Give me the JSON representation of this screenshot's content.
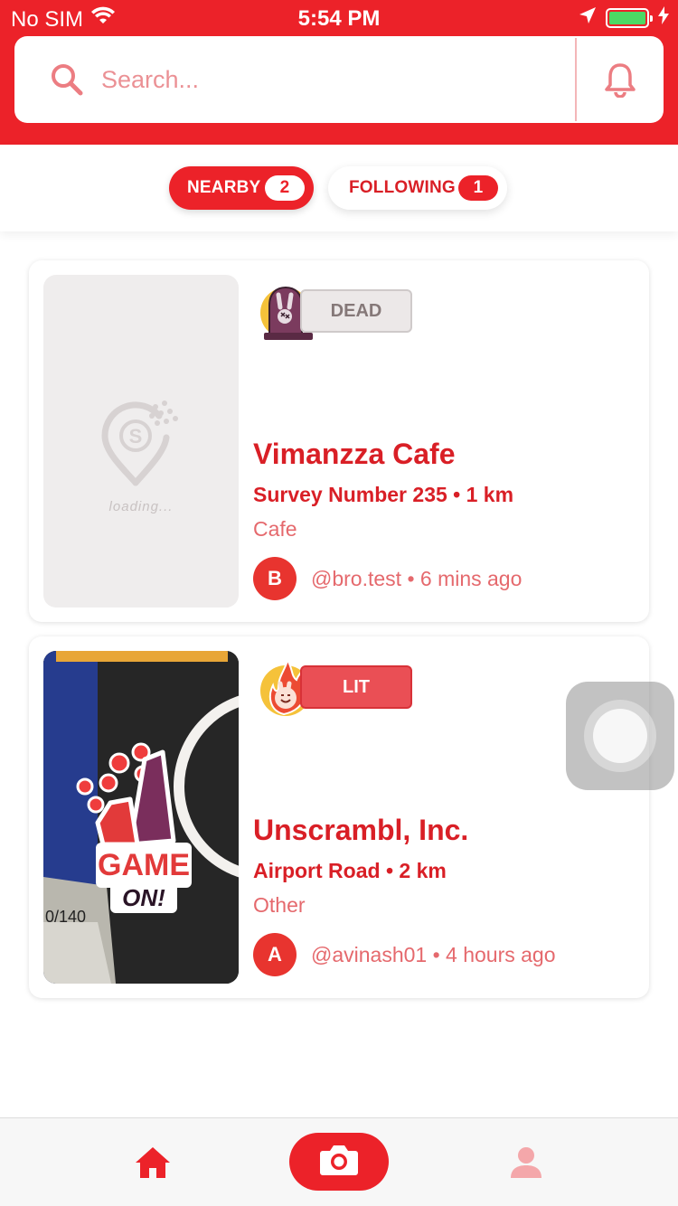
{
  "status_bar": {
    "carrier": "No SIM",
    "time": "5:54 PM"
  },
  "search": {
    "placeholder": "Search..."
  },
  "tabs": [
    {
      "label": "NEARBY",
      "count": "2",
      "active": true
    },
    {
      "label": "FOLLOWING",
      "count": "1",
      "active": false
    }
  ],
  "posts": [
    {
      "status": "DEAD",
      "mood_icon": "gravestone-bunny-icon",
      "image_state": "loading...",
      "name": "Vimanzza Cafe",
      "address": "Survey Number 235 • 1 km",
      "category": "Cafe",
      "avatar_initial": "B",
      "author_line": "@bro.test • 6 mins ago"
    },
    {
      "status": "LIT",
      "mood_icon": "fire-bunny-icon",
      "image_sticker": "GAME ON!",
      "name": "Unscrambl, Inc.",
      "address": "Airport Road • 2 km",
      "category": "Other",
      "avatar_initial": "A",
      "author_line": "@avinash01 • 4 hours ago"
    }
  ],
  "colors": {
    "brand": "#EC2229",
    "text_light": "#E5696D",
    "dead_badge": "#ECE8E8",
    "lit_badge": "#EA4F55"
  },
  "bottom_nav": {
    "items": [
      "home-icon",
      "camera-icon",
      "profile-icon"
    ],
    "active": "home-icon"
  }
}
